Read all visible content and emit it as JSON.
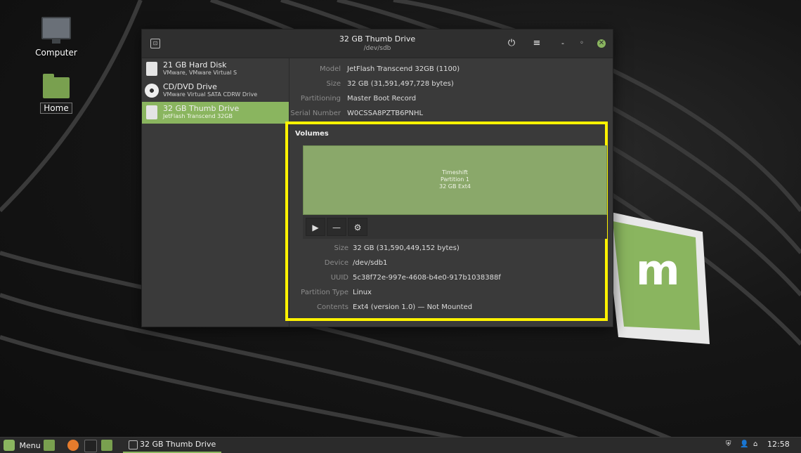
{
  "desktop": {
    "icons": [
      {
        "label": "Computer"
      },
      {
        "label": "Home"
      }
    ]
  },
  "window": {
    "title": "32 GB Thumb Drive",
    "subtitle": "/dev/sdb",
    "buttons": {
      "power": "⏻",
      "menu": "≡",
      "minimize": "-",
      "maximize": "◦",
      "close": "✕"
    }
  },
  "drives": [
    {
      "name": "21 GB Hard Disk",
      "sub": "VMware, VMware Virtual S",
      "selected": false
    },
    {
      "name": "CD/DVD Drive",
      "sub": "VMware Virtual SATA CDRW Drive",
      "selected": false
    },
    {
      "name": "32 GB Thumb Drive",
      "sub": "JetFlash Transcend 32GB",
      "selected": true
    }
  ],
  "disk_info": [
    {
      "key": "Model",
      "value": "JetFlash Transcend 32GB (1100)"
    },
    {
      "key": "Size",
      "value": "32 GB (31,591,497,728 bytes)"
    },
    {
      "key": "Partitioning",
      "value": "Master Boot Record"
    },
    {
      "key": "Serial Number",
      "value": "W0CSSA8PZTB6PNHL"
    }
  ],
  "volumes": {
    "title": "Volumes",
    "partition": {
      "line1": "Timeshift",
      "line2": "Partition 1",
      "line3": "32 GB Ext4"
    },
    "toolbar": {
      "play": "▶",
      "remove": "—",
      "settings": "⚙"
    },
    "details": [
      {
        "key": "Size",
        "value": "32 GB (31,590,449,152 bytes)"
      },
      {
        "key": "Device",
        "value": "/dev/sdb1"
      },
      {
        "key": "UUID",
        "value": "5c38f72e-997e-4608-b4e0-917b1038388f"
      },
      {
        "key": "Partition Type",
        "value": "Linux"
      },
      {
        "key": "Contents",
        "value": "Ext4 (version 1.0) — Not Mounted"
      }
    ]
  },
  "taskbar": {
    "menu_label": "Menu",
    "task_label": "32 GB Thumb Drive",
    "clock": "12:58"
  },
  "colors": {
    "accent": "#8ab55f",
    "highlight_box": "#fff200"
  }
}
